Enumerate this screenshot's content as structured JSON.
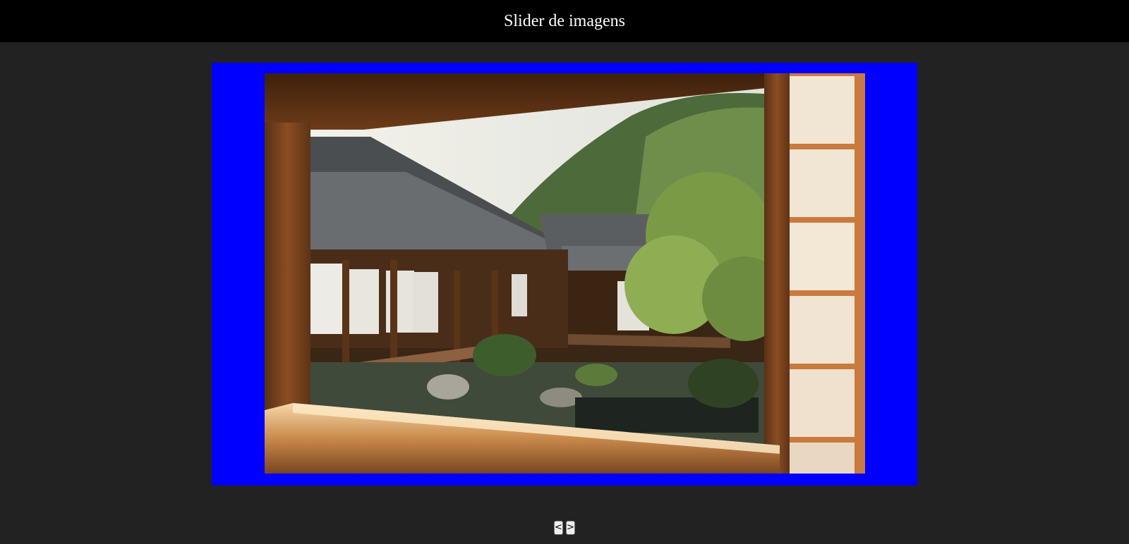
{
  "page": {
    "title": "Slider de imagens"
  },
  "slider": {
    "frame_color": "#0000ff",
    "current_slide": {
      "description_icon": "japanese-courtyard-photo"
    },
    "controls": {
      "prev_label": "<",
      "next_label": ">"
    }
  }
}
